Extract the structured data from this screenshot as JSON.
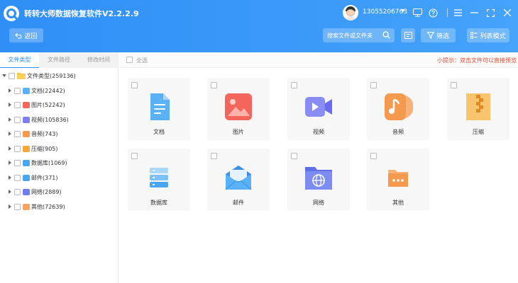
{
  "app": {
    "title": "转转大师数据恢复软件V2.2.2.9",
    "phone": "13055206763"
  },
  "toolbar": {
    "back_label": "返回",
    "search_placeholder": "搜索文件或文件夹",
    "filter_label": "筛选",
    "list_mode_label": "列表模式"
  },
  "left_tabs": [
    {
      "label": "文件类型",
      "active": true
    },
    {
      "label": "文件路径",
      "active": false
    },
    {
      "label": "修改时间",
      "active": false
    }
  ],
  "tree": {
    "root": "文件类型(259136)",
    "items": [
      {
        "label": "文档(22442)",
        "color": "#5ab1f6"
      },
      {
        "label": "图片(52242)",
        "color": "#f2665c"
      },
      {
        "label": "视频(105836)",
        "color": "#7d7ef2"
      },
      {
        "label": "音频(743)",
        "color": "#f49a4e"
      },
      {
        "label": "压缩(905)",
        "color": "#f5a73b"
      },
      {
        "label": "数据库(1069)",
        "color": "#4aa6f0"
      },
      {
        "label": "邮件(371)",
        "color": "#4aa6f0"
      },
      {
        "label": "网络(2889)",
        "color": "#6d7cf0"
      },
      {
        "label": "其他(72639)",
        "color": "#f5a463"
      }
    ]
  },
  "content": {
    "select_all": "全选",
    "tip": "小提示：双击文件可以直接预览",
    "cards": [
      {
        "label": "文档",
        "icon": "document-icon"
      },
      {
        "label": "图片",
        "icon": "image-icon"
      },
      {
        "label": "视频",
        "icon": "video-icon"
      },
      {
        "label": "音频",
        "icon": "audio-icon"
      },
      {
        "label": "压缩",
        "icon": "archive-icon"
      },
      {
        "label": "数据库",
        "icon": "database-icon"
      },
      {
        "label": "邮件",
        "icon": "mail-icon"
      },
      {
        "label": "网络",
        "icon": "network-icon"
      },
      {
        "label": "其他",
        "icon": "other-icon"
      }
    ]
  }
}
